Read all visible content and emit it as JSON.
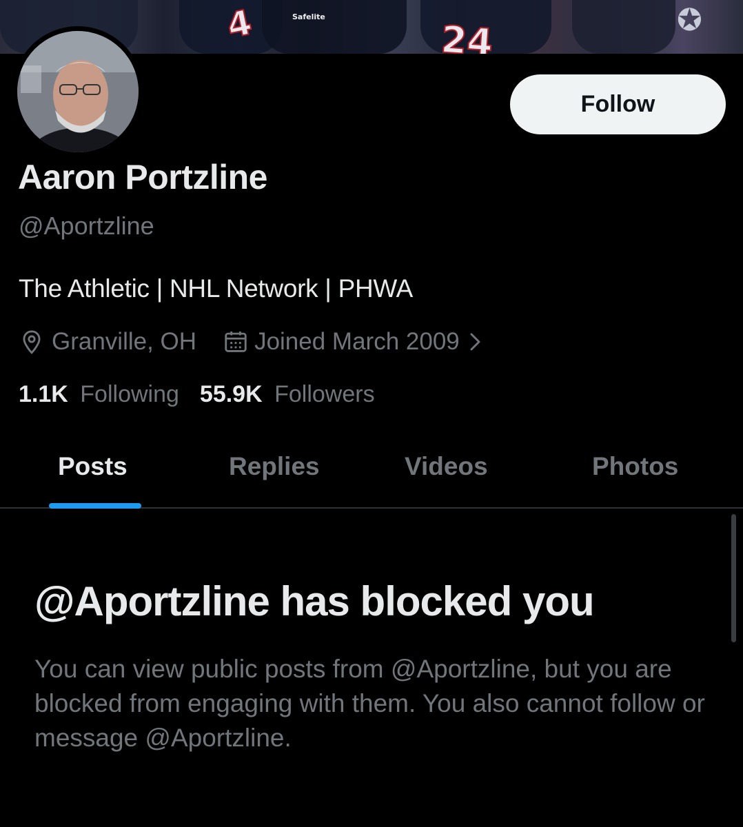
{
  "banner": {
    "numbers": [
      "4",
      "24"
    ],
    "sponsor": "Safelite"
  },
  "profile": {
    "name": "Aaron Portzline",
    "handle": "@Aportzline",
    "bio": "The Athletic | NHL Network | PHWA",
    "location": "Granville, OH",
    "joined": "Joined March 2009",
    "following_count": "1.1K",
    "following_label": "Following",
    "followers_count": "55.9K",
    "followers_label": "Followers"
  },
  "actions": {
    "follow_label": "Follow"
  },
  "tabs": [
    {
      "label": "Posts",
      "active": true
    },
    {
      "label": "Replies",
      "active": false
    },
    {
      "label": "Videos",
      "active": false
    },
    {
      "label": "Photos",
      "active": false
    }
  ],
  "blocked": {
    "title": "@Aportzline has blocked you",
    "message": "You can view public posts from @Aportzline, but you are blocked from engaging with them. You also cannot follow or message @Aportzline."
  },
  "colors": {
    "background": "#000000",
    "primary_text": "#e7e9ea",
    "secondary_text": "#71767b",
    "accent": "#1d9bf0",
    "button_bg": "#eff3f4"
  },
  "icons": [
    "location-pin-icon",
    "calendar-icon",
    "chevron-right-icon"
  ]
}
